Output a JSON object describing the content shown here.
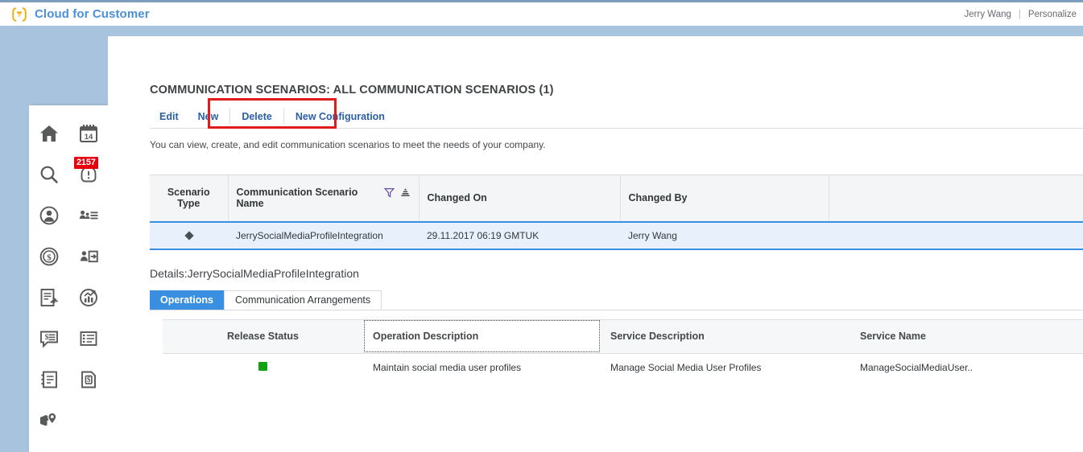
{
  "header": {
    "logo_icon": "sap-brand-icon",
    "title": "Cloud for Customer",
    "user_name": "Jerry Wang",
    "separator": "|",
    "personalize_label": "Personalize"
  },
  "sidebar": {
    "items": [
      {
        "icon": "home-icon",
        "label": "Home"
      },
      {
        "icon": "calendar-icon",
        "label": "Calendar"
      },
      {
        "icon": "search-icon",
        "label": "Search"
      },
      {
        "icon": "alert-icon",
        "label": "Alerts",
        "badge": "2157"
      },
      {
        "icon": "customer-icon",
        "label": "Customers"
      },
      {
        "icon": "people-list-icon",
        "label": "People"
      },
      {
        "icon": "sales-icon",
        "label": "Sales"
      },
      {
        "icon": "activity-planner-icon",
        "label": "Activity Planner"
      },
      {
        "icon": "visits-icon",
        "label": "Visits"
      },
      {
        "icon": "analysis-icon",
        "label": "Analysis"
      },
      {
        "icon": "feed-icon",
        "label": "Feed"
      },
      {
        "icon": "library-icon",
        "label": "Library"
      },
      {
        "icon": "contacts-book-icon",
        "label": "Contacts"
      },
      {
        "icon": "price-sheet-icon",
        "label": "Pricing"
      },
      {
        "icon": "map-pin-icon",
        "label": "Map"
      }
    ]
  },
  "main": {
    "page_title": "COMMUNICATION SCENARIOS: ALL COMMUNICATION SCENARIOS (1)",
    "toolbar": {
      "edit_label": "Edit",
      "new_label": "New",
      "delete_label": "Delete",
      "new_configuration_label": "New Configuration",
      "highlight_color": "#e01b1b"
    },
    "description": "You can view, create, and edit communication scenarios to meet the needs of your company.",
    "scenarios_table": {
      "columns": [
        "Scenario Type",
        "Communication Scenario Name",
        "Changed On",
        "Changed By",
        ""
      ],
      "header_icons": {
        "filter": "filter-icon",
        "sort": "sort-icon"
      },
      "rows": [
        {
          "scenario_type": "diamond-marker",
          "scenario_name": "JerrySocialMediaProfileIntegration",
          "changed_on": "29.11.2017 06:19 GMTUK",
          "changed_by": "Jerry Wang",
          "extra": "",
          "selected": true
        }
      ]
    },
    "details": {
      "title": "Details:JerrySocialMediaProfileIntegration",
      "tabs": [
        {
          "label": "Operations",
          "active": true
        },
        {
          "label": "Communication Arrangements",
          "active": false
        }
      ],
      "operations_table": {
        "columns": [
          "Release Status",
          "Operation Description",
          "Service Description",
          "Service Name"
        ],
        "focused_column": "Operation Description",
        "rows": [
          {
            "release_status": "green-status-dot",
            "operation_description": "Maintain social media user profiles",
            "service_description": "Manage Social Media User Profiles",
            "service_name": "ManageSocialMediaUser.."
          }
        ]
      }
    }
  },
  "colors": {
    "brand_blue": "#4a90d9",
    "accent_blue": "#3b8fe0",
    "link_blue": "#2a5fa8",
    "background_blue": "#a8c3de",
    "badge_red": "#e8000d",
    "status_green": "#12a014",
    "highlight_red": "#e01b1b"
  }
}
